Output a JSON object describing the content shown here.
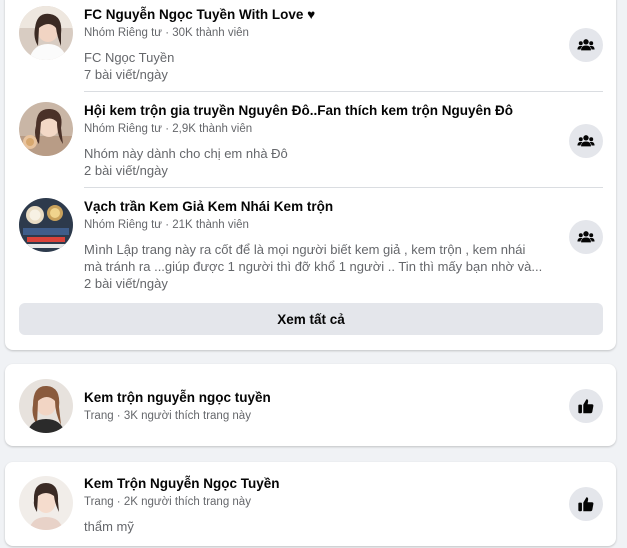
{
  "groups": {
    "items": [
      {
        "title": "FC Nguyễn Ngọc Tuyền With Love ♥",
        "meta": "Nhóm Riêng tư · 30K thành viên",
        "desc_lines": [
          "FC Ngọc Tuyền",
          "7 bài viết/ngày"
        ],
        "icon": "group-icon"
      },
      {
        "title": "Hội kem trộn gia truyền Nguyên Đô..Fan thích kem trộn Nguyên Đô",
        "meta": "Nhóm Riêng tư · 2,9K thành viên",
        "desc_lines": [
          "Nhóm này dành cho chị em nhà Đô",
          "2 bài viết/ngày"
        ],
        "icon": "group-icon"
      },
      {
        "title": "Vạch trần Kem Giả Kem Nhái Kem trộn",
        "meta": "Nhóm Riêng tư · 21K thành viên",
        "desc_lines": [
          "Mình Lập trang này ra cốt để là mọi người biết kem giả , kem trộn , kem nhái",
          "mà tránh ra ...giúp được 1 người thì đỡ khổ 1 người .. Tin thì mấy bạn nhờ và...",
          "2 bài viết/ngày"
        ],
        "icon": "group-icon"
      }
    ],
    "see_all_label": "Xem tất cả"
  },
  "pages": [
    {
      "title": "Kem trộn nguyễn ngọc tuyền",
      "meta": "Trang · 3K người thích trang này",
      "desc": "",
      "icon": "thumbs-up-icon"
    },
    {
      "title": "Kem Trộn Nguyễn Ngọc Tuyền",
      "meta": "Trang · 2K người thích trang này",
      "desc": "thẩm mỹ",
      "icon": "thumbs-up-icon"
    }
  ],
  "colors": {
    "background": "#f0f2f5",
    "card": "#ffffff",
    "button": "#e4e6eb",
    "secondary_text": "#65676b"
  }
}
